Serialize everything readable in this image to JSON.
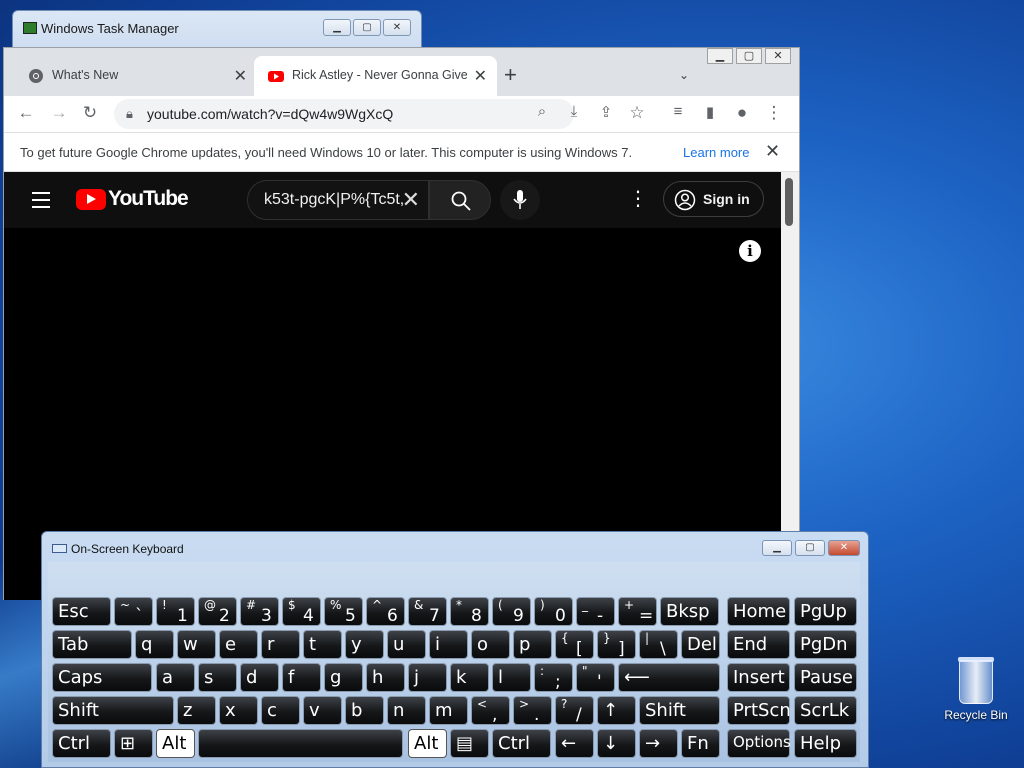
{
  "desktop": {
    "recycle_bin_label": "Recycle Bin"
  },
  "task_manager": {
    "title": "Windows Task Manager"
  },
  "chrome": {
    "tabs": [
      {
        "label": "What's New",
        "close": "✕"
      },
      {
        "label": "Rick Astley - Never Gonna Give You Up",
        "close": "✕"
      }
    ],
    "new_tab": "+",
    "url": "youtube.com/watch?v=dQw4w9WgXcQ",
    "infobar": {
      "message": "To get future Google Chrome updates, you'll need Windows 10 or later. This computer is using Windows 7.",
      "learn_more": "Learn more",
      "close": "✕"
    }
  },
  "youtube": {
    "logo_text": "YouTube",
    "search_value": "k53t-pgcK|P%{Tc5t,",
    "sign_in": "Sign in",
    "info": "i"
  },
  "osk": {
    "title": "On-Screen Keyboard",
    "rows": [
      [
        {
          "main": "Esc"
        },
        {
          "sh": "~",
          "ba": "`"
        },
        {
          "sh": "!",
          "ba": "1"
        },
        {
          "sh": "@",
          "ba": "2"
        },
        {
          "sh": "#",
          "ba": "3"
        },
        {
          "sh": "$",
          "ba": "4"
        },
        {
          "sh": "%",
          "ba": "5"
        },
        {
          "sh": "^",
          "ba": "6"
        },
        {
          "sh": "&",
          "ba": "7"
        },
        {
          "sh": "*",
          "ba": "8"
        },
        {
          "sh": "(",
          "ba": "9"
        },
        {
          "sh": ")",
          "ba": "0"
        },
        {
          "sh": "_",
          "ba": "-"
        },
        {
          "sh": "+",
          "ba": "="
        },
        {
          "main": "Bksp"
        },
        {
          "main": "Home"
        },
        {
          "main": "PgUp"
        }
      ],
      [
        {
          "main": "Tab"
        },
        {
          "main": "q"
        },
        {
          "main": "w"
        },
        {
          "main": "e"
        },
        {
          "main": "r"
        },
        {
          "main": "t"
        },
        {
          "main": "y"
        },
        {
          "main": "u"
        },
        {
          "main": "i"
        },
        {
          "main": "o"
        },
        {
          "main": "p"
        },
        {
          "sh": "{",
          "ba": "["
        },
        {
          "sh": "}",
          "ba": "]"
        },
        {
          "sh": "|",
          "ba": "\\"
        },
        {
          "main": "Del"
        },
        {
          "main": "End"
        },
        {
          "main": "PgDn"
        }
      ],
      [
        {
          "main": "Caps"
        },
        {
          "main": "a"
        },
        {
          "main": "s"
        },
        {
          "main": "d"
        },
        {
          "main": "f"
        },
        {
          "main": "g"
        },
        {
          "main": "h"
        },
        {
          "main": "j"
        },
        {
          "main": "k"
        },
        {
          "main": "l"
        },
        {
          "sh": ":",
          "ba": ";"
        },
        {
          "sh": "\"",
          "ba": "'"
        },
        {
          "main": "⟵"
        },
        {
          "main": "Insert"
        },
        {
          "main": "Pause"
        }
      ],
      [
        {
          "main": "Shift"
        },
        {
          "main": "z"
        },
        {
          "main": "x"
        },
        {
          "main": "c"
        },
        {
          "main": "v"
        },
        {
          "main": "b"
        },
        {
          "main": "n"
        },
        {
          "main": "m"
        },
        {
          "sh": "<",
          "ba": ","
        },
        {
          "sh": ">",
          "ba": "."
        },
        {
          "sh": "?",
          "ba": "/"
        },
        {
          "main": "↑"
        },
        {
          "main": "Shift"
        },
        {
          "main": "PrtScn"
        },
        {
          "main": "ScrLk"
        }
      ],
      [
        {
          "main": "Ctrl"
        },
        {
          "main": "⊞"
        },
        {
          "main": "Alt"
        },
        {
          "main": ""
        },
        {
          "main": "Alt"
        },
        {
          "main": "▤"
        },
        {
          "main": "Ctrl"
        },
        {
          "main": "←"
        },
        {
          "main": "↓"
        },
        {
          "main": "→"
        },
        {
          "main": "Fn"
        },
        {
          "main": "Options"
        },
        {
          "main": "Help"
        }
      ]
    ]
  },
  "colors": {
    "youtube_red": "#ff0000",
    "chrome_link": "#1a73e8",
    "key_dark": "#151719"
  }
}
